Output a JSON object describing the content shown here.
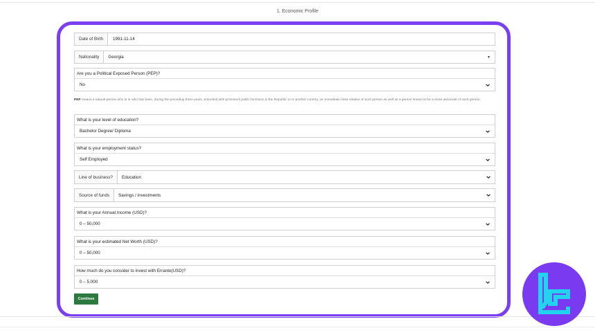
{
  "step_title": "1. Economic Profile",
  "date_of_birth": {
    "label": "Date of Birth",
    "value": "1991-11-14"
  },
  "nationality": {
    "label": "Nationality",
    "value": "Georgia"
  },
  "pep": {
    "label": "Are you a Political Exposed Person (PEP)?",
    "value": "No"
  },
  "pep_note": {
    "term": "PEP",
    "text": " means a natural person who is or who has been, during the preceding three years, entrusted with prominent public functions in the Republic or in another country, an immediate close relative of such person as well as a person known to be a close associate of such person."
  },
  "education": {
    "label": "What is your level of education?",
    "value": "Bachelor Degree/ Diploma"
  },
  "employment": {
    "label": "What is your employment status?",
    "value": "Self Employed"
  },
  "line_of_business": {
    "label": "Line of business?",
    "value": "Education"
  },
  "source_of_funds": {
    "label": "Source of funds",
    "value": "Savings / investments"
  },
  "annual_income": {
    "label": "What is your Annual Income (USD)?",
    "value": "0 – 50,000"
  },
  "net_worth": {
    "label": "What is your estimated Net Worth (USD)?",
    "value": "0 – 50,000"
  },
  "invest_amount": {
    "label": "How much do you consider to invest with Errante(USD)?",
    "value": "0 – 5,000"
  },
  "continue_label": "Continue",
  "colors": {
    "frame": "#7b3ff2",
    "button": "#2c7a3f",
    "logo_bg": "#7a3af0",
    "logo_cyan": "#22d3ee"
  },
  "icons": {
    "select_caret": "chevron-down-icon",
    "logo": "tradingfinder-logo"
  }
}
